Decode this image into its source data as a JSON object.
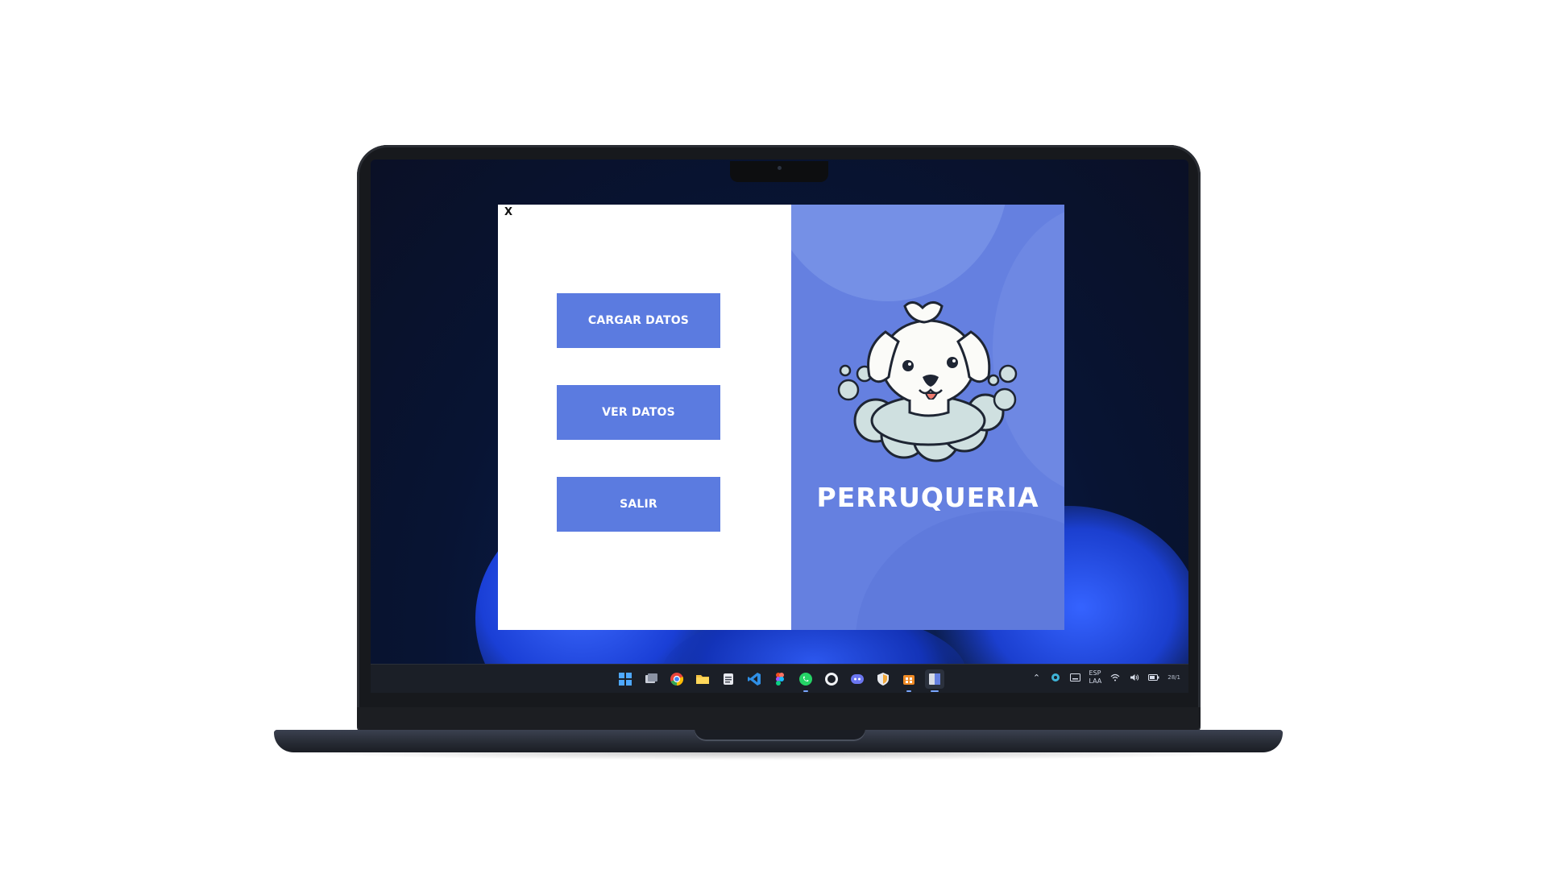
{
  "window": {
    "close_label": "X"
  },
  "menu": {
    "buttons": [
      {
        "label": "CARGAR DATOS"
      },
      {
        "label": "VER DATOS"
      },
      {
        "label": "SALIR"
      }
    ]
  },
  "brand": {
    "name": "PERRUQUERIA",
    "logo_icon": "dog-in-bubbles-icon"
  },
  "taskbar": {
    "apps": [
      "windows-start-icon",
      "task-view-icon",
      "chrome-icon",
      "file-explorer-icon",
      "notepad-icon",
      "vscode-icon",
      "figma-icon",
      "whatsapp-icon",
      "github-icon",
      "discord-icon",
      "security-shield-icon",
      "store-icon",
      "app-window-icon"
    ],
    "tray": {
      "language_top": "ESP",
      "language_bottom": "LAA",
      "clock": "28/1"
    }
  },
  "colors": {
    "accent": "#5b7be0",
    "panel": "#6580e0",
    "taskbar": "#1b1f27"
  }
}
